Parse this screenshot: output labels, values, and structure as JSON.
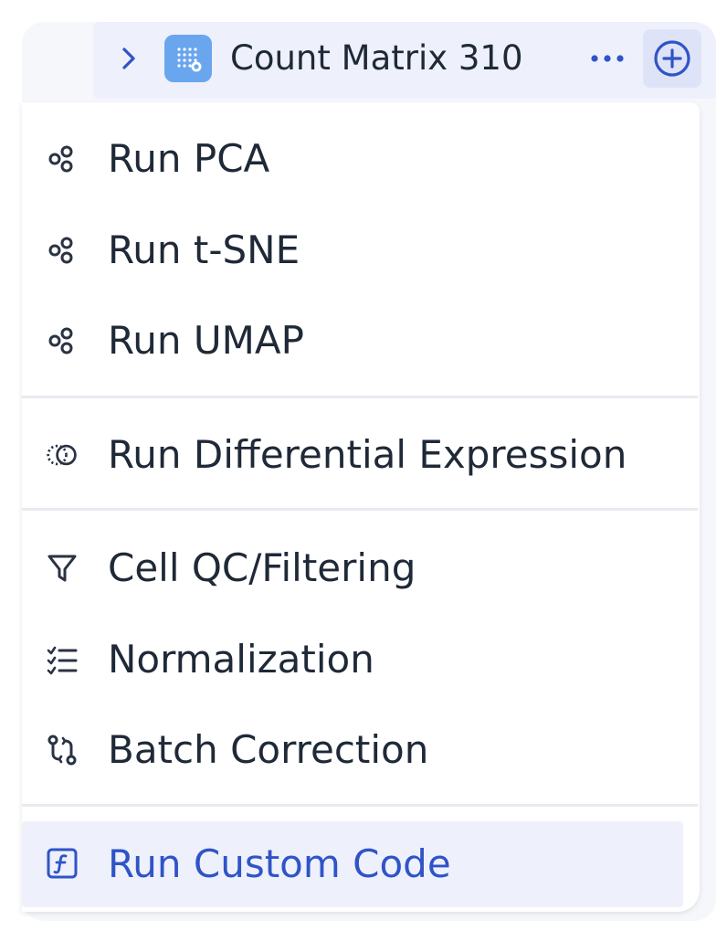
{
  "node": {
    "title": "Count Matrix 310",
    "icons": {
      "expand": "chevron-right-icon",
      "type": "matrix-grid-icon",
      "more": "ellipsis-icon",
      "add": "plus-circle-icon"
    }
  },
  "menu": {
    "groups": [
      {
        "items": [
          {
            "label": "Run PCA",
            "icon": "scatter-nodes-icon"
          },
          {
            "label": "Run t-SNE",
            "icon": "scatter-nodes-icon"
          },
          {
            "label": "Run UMAP",
            "icon": "scatter-nodes-icon"
          }
        ]
      },
      {
        "items": [
          {
            "label": "Run Differential Expression",
            "icon": "venn-circles-icon"
          }
        ]
      },
      {
        "items": [
          {
            "label": "Cell QC/Filtering",
            "icon": "filter-funnel-icon"
          },
          {
            "label": "Normalization",
            "icon": "checklist-icon"
          },
          {
            "label": "Batch Correction",
            "icon": "git-compare-icon"
          }
        ]
      },
      {
        "items": [
          {
            "label": "Run Custom Code",
            "icon": "function-square-icon",
            "highlighted": true
          }
        ]
      }
    ]
  },
  "colors": {
    "accent": "#2f54c8",
    "text": "#1f2937",
    "icon_dark": "#2a3342",
    "node_icon_bg": "#6aa6ee",
    "hover_bg": "#eef0fb",
    "divider": "#e8eaef"
  }
}
